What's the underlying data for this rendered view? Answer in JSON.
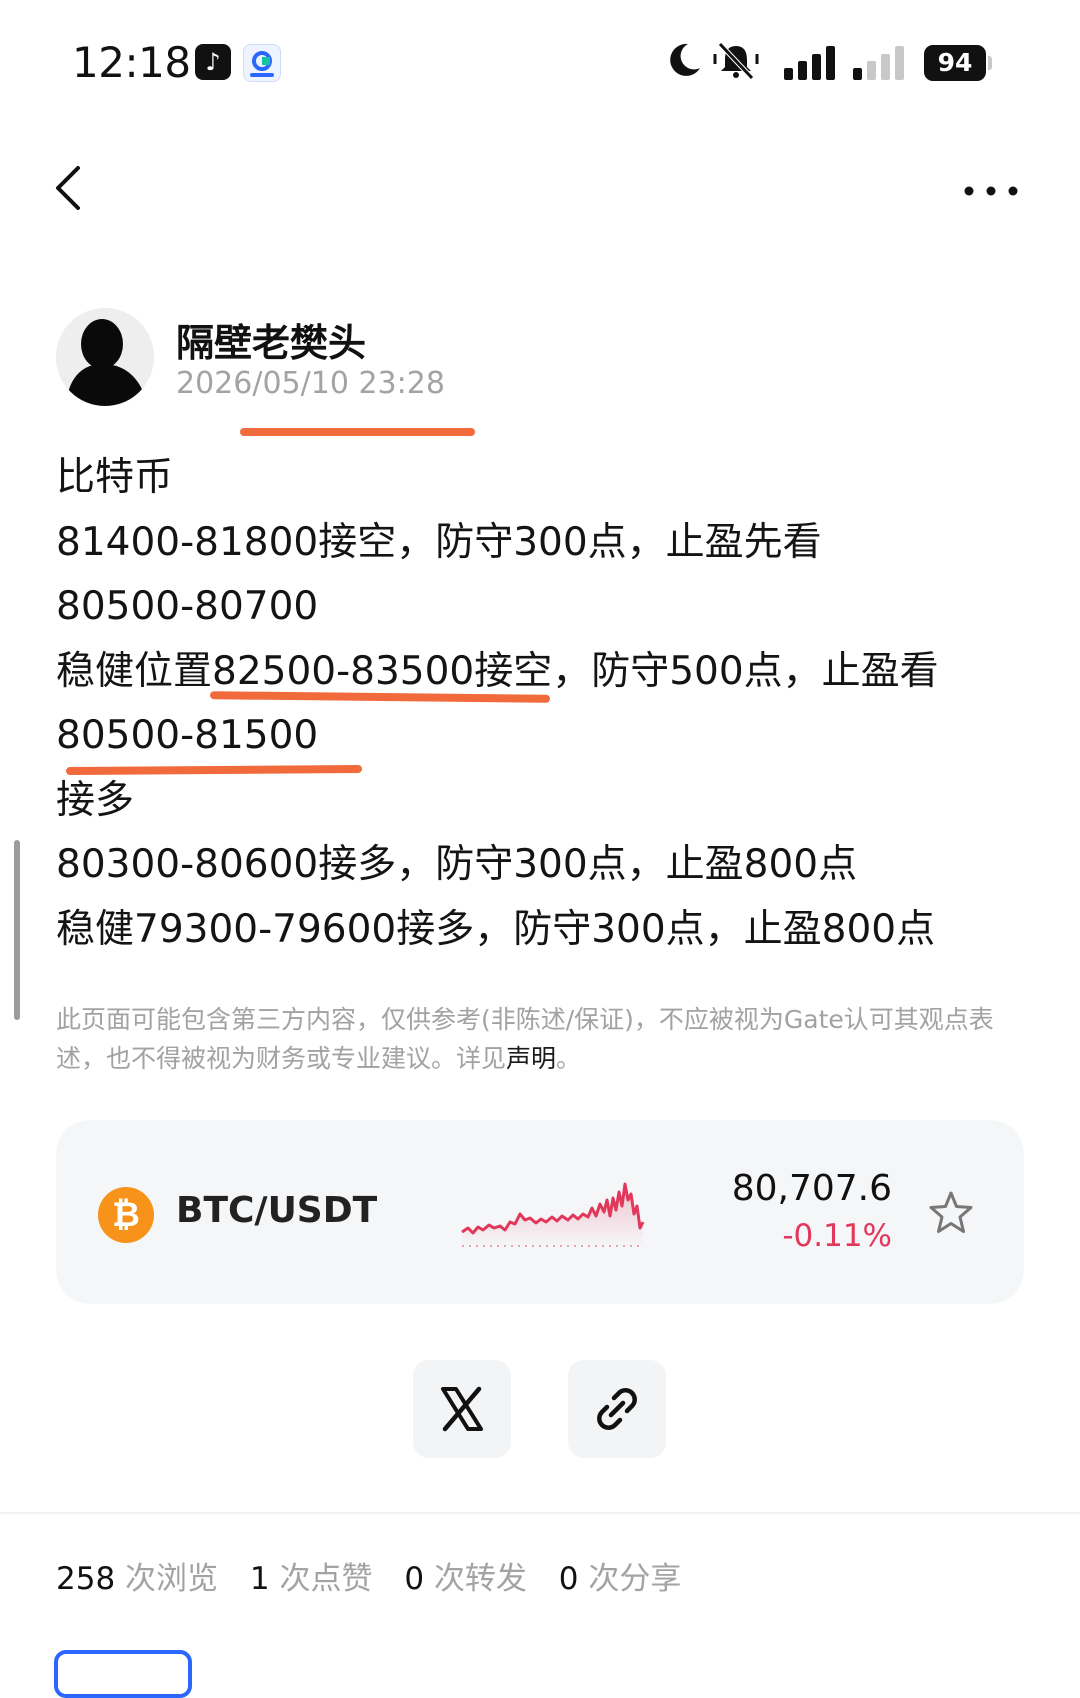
{
  "status_bar": {
    "time": "12:18",
    "battery": "94",
    "icons": [
      "tiktok-icon",
      "gate-app-icon",
      "moon-icon",
      "silent-bell-icon",
      "signal-bars-icon",
      "signal-bars-icon"
    ]
  },
  "nav": {
    "back_icon": "chevron-left-icon",
    "more_icon": "more-dots-icon"
  },
  "author": {
    "name": "隔壁老樊头",
    "time": "2026/05/10 23:28"
  },
  "post": {
    "lines": [
      "比特币",
      "81400-81800接空，防守300点，止盈先看",
      "80500-80700",
      "稳健位置82500-83500接空，防守500点，止盈看",
      "80500-81500",
      "接多",
      "80300-80600接多，防守300点，止盈800点",
      "稳健79300-79600接多，防守300点，止盈800点"
    ]
  },
  "disclaimer": {
    "text": "此页面可能包含第三方内容，仅供参考(非陈述/保证)，不应被视为Gate认可其观点表述，也不得被视为财务或专业建议。详见",
    "link": "声明",
    "end": "。"
  },
  "ticker": {
    "pair": "BTC/USDT",
    "coin_symbol": "₿",
    "price": "80,707.6",
    "change": "-0.11%",
    "change_color": "#e0375b",
    "coin_color": "#f7931a",
    "favorite_icon": "star-outline-icon"
  },
  "share": {
    "x_icon": "x-logo-icon",
    "link_icon": "link-icon"
  },
  "stats": [
    {
      "value": "258",
      "label": "次浏览"
    },
    {
      "value": "1",
      "label": "次点赞"
    },
    {
      "value": "0",
      "label": "次转发"
    },
    {
      "value": "0",
      "label": "次分享"
    }
  ]
}
